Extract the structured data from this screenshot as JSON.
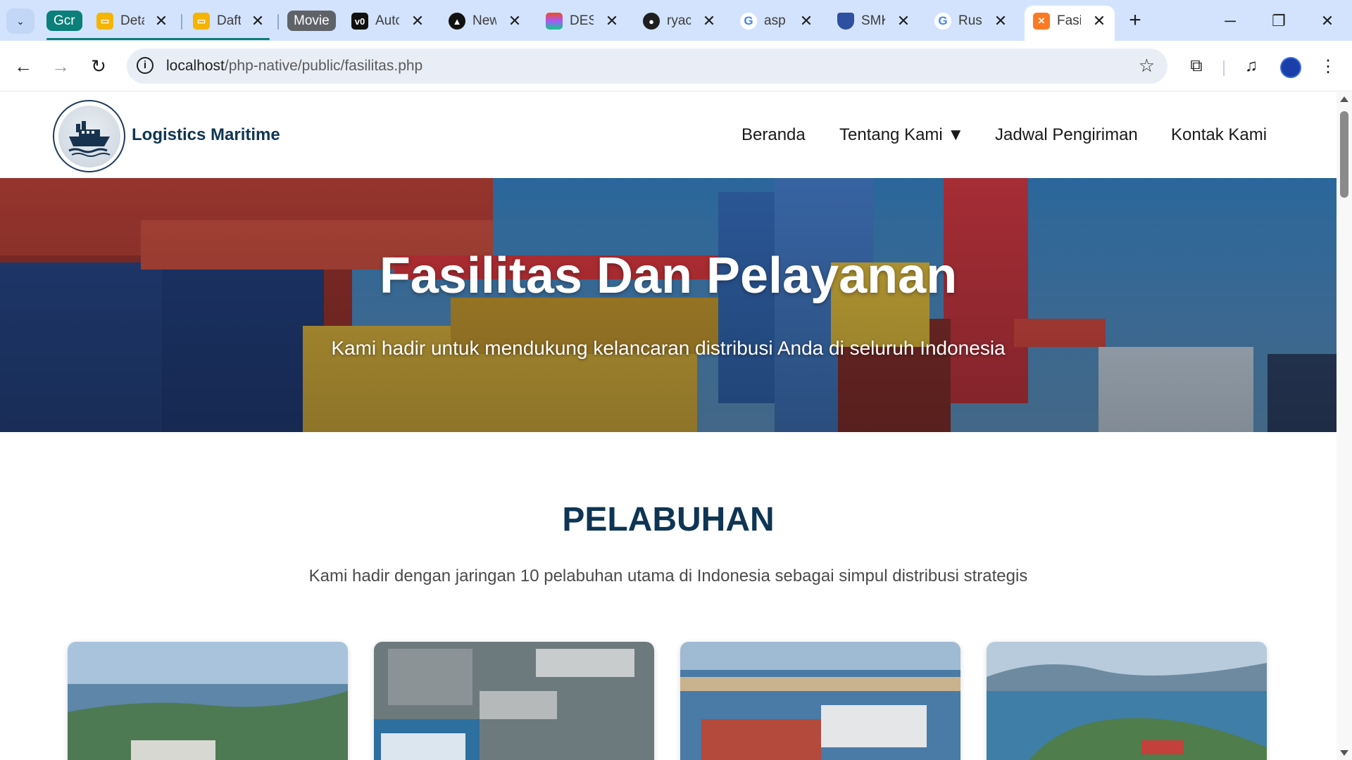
{
  "browser": {
    "tab_groups": [
      {
        "label": "Gcr",
        "color": "#0b7f7a"
      },
      {
        "label": "Movie",
        "color": "#5f6368"
      }
    ],
    "tabs": [
      {
        "title": "Deta",
        "favicon": "slides-icon"
      },
      {
        "title": "Daft",
        "favicon": "slides-icon"
      },
      {
        "title": "Auto",
        "favicon": "v0-icon"
      },
      {
        "title": "New",
        "favicon": "triangle-logo-icon"
      },
      {
        "title": "DES",
        "favicon": "figma-icon"
      },
      {
        "title": "ryac",
        "favicon": "github-icon"
      },
      {
        "title": "asp",
        "favicon": "google-icon"
      },
      {
        "title": "SMK",
        "favicon": "shield-icon"
      },
      {
        "title": "Rus",
        "favicon": "google-icon"
      },
      {
        "title": "Fasi",
        "favicon": "xampp-icon",
        "active": true
      }
    ],
    "url_host": "localhost",
    "url_path": "/php-native/public/fasilitas.php"
  },
  "site": {
    "brand": "Logistics Maritime",
    "nav": [
      {
        "label": "Beranda"
      },
      {
        "label": "Tentang Kami ▼"
      },
      {
        "label": "Jadwal Pengiriman"
      },
      {
        "label": "Kontak Kami"
      }
    ]
  },
  "hero": {
    "title": "Fasilitas Dan Pelayanan",
    "subtitle": "Kami hadir untuk mendukung kelancaran distribusi Anda di seluruh Indonesia"
  },
  "section": {
    "title": "PELABUHAN",
    "description": "Kami hadir dengan jaringan 10 pelabuhan utama di Indonesia sebagai simpul distribusi strategis"
  },
  "colors": {
    "brand_navy": "#0f3554",
    "tab_strip": "#d3e3fd",
    "tab_group_teal": "#0b7f7a"
  }
}
